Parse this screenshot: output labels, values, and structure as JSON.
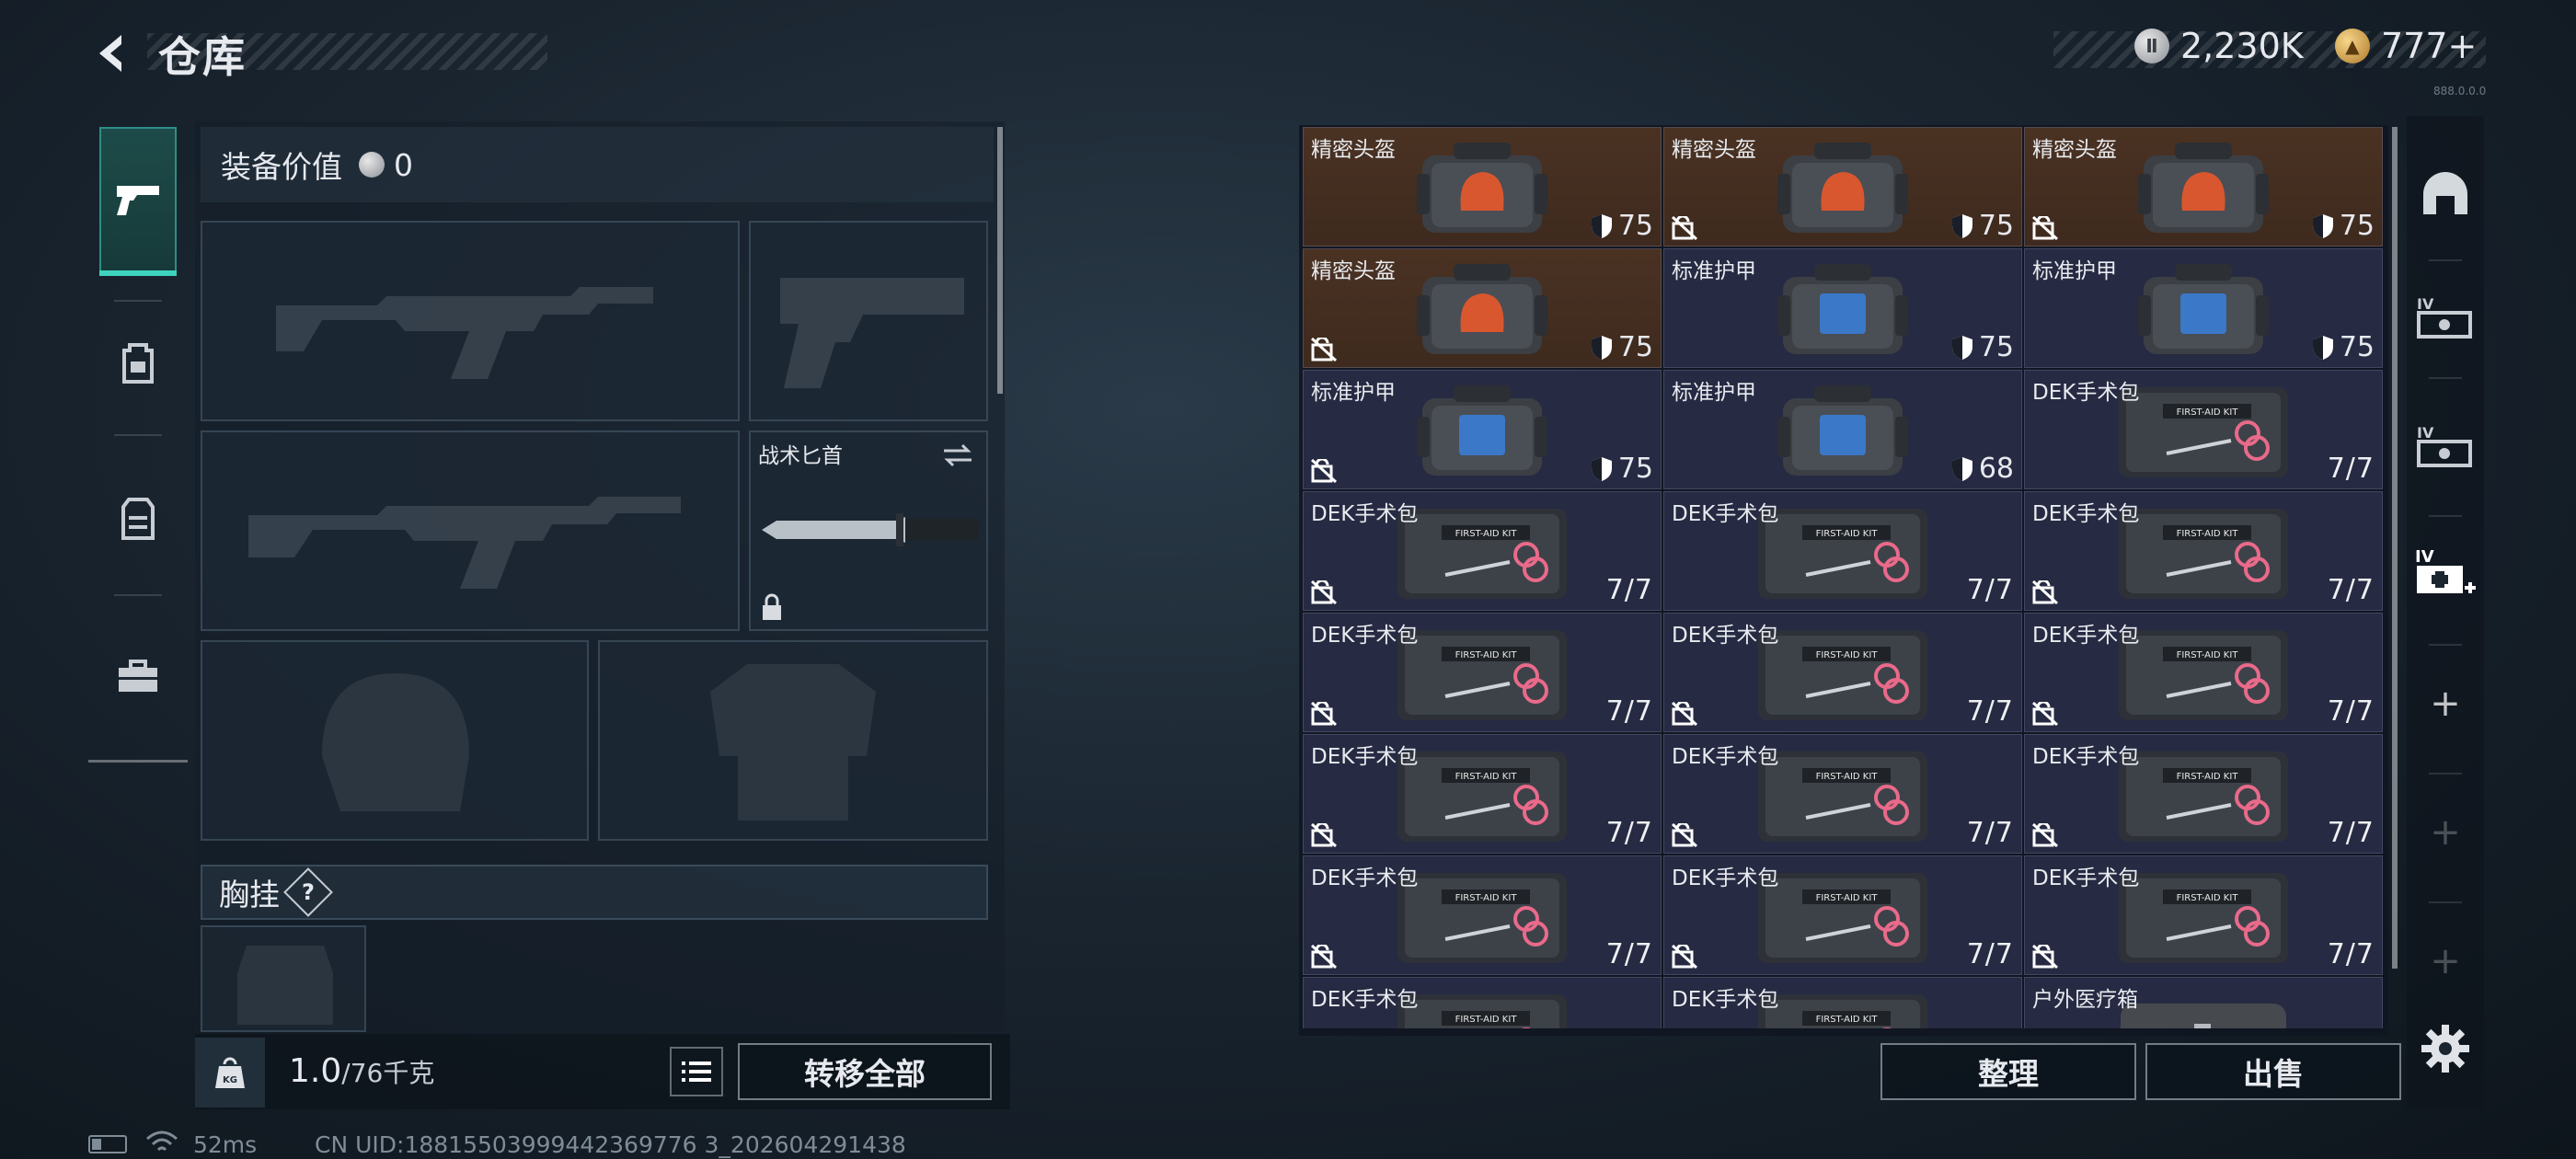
{
  "header": {
    "title": "仓库",
    "currencies": [
      {
        "icon": "silver-coin-icon",
        "value": "2,230K"
      },
      {
        "icon": "gold-coin-icon",
        "value": "777+"
      }
    ],
    "version": "888.0.0.0"
  },
  "left_tabs": [
    {
      "name": "pistol-icon",
      "active": true
    },
    {
      "name": "backpack-icon",
      "active": false
    },
    {
      "name": "vest-icon",
      "active": false
    },
    {
      "name": "toolbox-icon",
      "active": false
    }
  ],
  "equipment": {
    "value_label": "装备价值",
    "value": "0",
    "knife_label": "战术匕首",
    "chest_rig_label": "胸挂",
    "help": "?"
  },
  "bottom_left": {
    "weight_value": "1.0",
    "weight_max": "/76千克",
    "transfer_all": "转移全部"
  },
  "warehouse": {
    "items": [
      {
        "name": "精密头盔",
        "type": "bag",
        "bg": "brown",
        "armor": "75",
        "nolock": false
      },
      {
        "name": "精密头盔",
        "type": "bag",
        "bg": "brown",
        "armor": "75",
        "nolock": true
      },
      {
        "name": "精密头盔",
        "type": "bag",
        "bg": "brown",
        "armor": "75",
        "nolock": true
      },
      {
        "name": "精密头盔",
        "type": "bag",
        "bg": "brown",
        "armor": "75",
        "nolock": true
      },
      {
        "name": "标准护甲",
        "type": "bag-blue",
        "bg": "blue",
        "armor": "75",
        "nolock": false
      },
      {
        "name": "标准护甲",
        "type": "bag-blue",
        "bg": "blue",
        "armor": "75",
        "nolock": false
      },
      {
        "name": "标准护甲",
        "type": "bag-blue",
        "bg": "blue",
        "armor": "75",
        "nolock": true
      },
      {
        "name": "标准护甲",
        "type": "bag-blue",
        "bg": "blue",
        "armor": "68",
        "nolock": false
      },
      {
        "name": "DEK手术包",
        "type": "kit",
        "bg": "blue",
        "qty": "7/7",
        "nolock": false
      },
      {
        "name": "DEK手术包",
        "type": "kit",
        "bg": "blue",
        "qty": "7/7",
        "nolock": true
      },
      {
        "name": "DEK手术包",
        "type": "kit",
        "bg": "blue",
        "qty": "7/7",
        "nolock": false
      },
      {
        "name": "DEK手术包",
        "type": "kit",
        "bg": "blue",
        "qty": "7/7",
        "nolock": true
      },
      {
        "name": "DEK手术包",
        "type": "kit",
        "bg": "blue",
        "qty": "7/7",
        "nolock": true
      },
      {
        "name": "DEK手术包",
        "type": "kit",
        "bg": "blue",
        "qty": "7/7",
        "nolock": true
      },
      {
        "name": "DEK手术包",
        "type": "kit",
        "bg": "blue",
        "qty": "7/7",
        "nolock": true
      },
      {
        "name": "DEK手术包",
        "type": "kit",
        "bg": "blue",
        "qty": "7/7",
        "nolock": true
      },
      {
        "name": "DEK手术包",
        "type": "kit",
        "bg": "blue",
        "qty": "7/7",
        "nolock": true
      },
      {
        "name": "DEK手术包",
        "type": "kit",
        "bg": "blue",
        "qty": "7/7",
        "nolock": true
      },
      {
        "name": "DEK手术包",
        "type": "kit",
        "bg": "blue",
        "qty": "7/7",
        "nolock": true
      },
      {
        "name": "DEK手术包",
        "type": "kit",
        "bg": "blue",
        "qty": "7/7",
        "nolock": true
      },
      {
        "name": "DEK手术包",
        "type": "kit",
        "bg": "blue",
        "qty": "7/7",
        "nolock": true
      },
      {
        "name": "DEK手术包",
        "type": "kit",
        "bg": "blue",
        "qty": "",
        "nolock": false
      },
      {
        "name": "DEK手术包",
        "type": "kit",
        "bg": "blue",
        "qty": "",
        "nolock": false
      },
      {
        "name": "户外医疗箱",
        "type": "box",
        "bg": "blue",
        "qty": "",
        "nolock": false
      }
    ],
    "sort_label": "整理",
    "sell_label": "出售"
  },
  "right_rail": [
    {
      "name": "helmet-slot-icon"
    },
    {
      "name": "iv-case-icon",
      "text": "IV"
    },
    {
      "name": "iv-case-icon-2",
      "text": "IV"
    },
    {
      "name": "iv-medkit-add-icon",
      "text": "IV"
    },
    {
      "name": "add-slot-plus",
      "text": "+"
    },
    {
      "name": "add-slot-plus-dim",
      "text": "+"
    },
    {
      "name": "add-slot-plus-dim-2",
      "text": "+"
    }
  ],
  "status_bar": {
    "ping": "52ms",
    "uid": "CN UID:18815503999442369776 3_202604291438"
  },
  "colors": {
    "accent": "#3fd3bf",
    "cell_brown": "#4a3223",
    "cell_blue": "#262a42"
  }
}
